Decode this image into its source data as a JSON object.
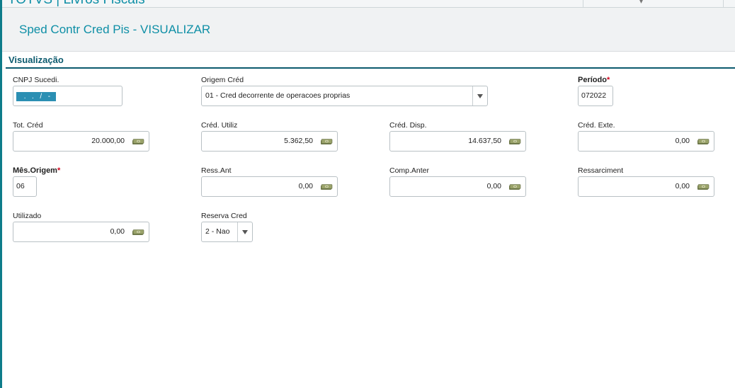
{
  "app": {
    "title": "TOTVS | Livros Fiscais"
  },
  "page": {
    "title": "Sped Contr Cred Pis - VISUALIZAR"
  },
  "section": {
    "title": "Visualização"
  },
  "fields": {
    "cnpj_sucedi": {
      "label": "CNPJ Sucedi.",
      "value": " .  .  /  -"
    },
    "origem_cred": {
      "label": "Origem Créd",
      "value": "01 - Cred decorrente de operacoes proprias"
    },
    "periodo": {
      "label": "Período",
      "required_mark": "*",
      "value": "072022"
    },
    "tot_cred": {
      "label": "Tot. Créd",
      "value": "20.000,00"
    },
    "cred_utiliz": {
      "label": "Créd. Utiliz",
      "value": "5.362,50"
    },
    "cred_disp": {
      "label": "Créd. Disp.",
      "value": "14.637,50"
    },
    "cred_exte": {
      "label": "Créd. Exte.",
      "value": "0,00"
    },
    "mes_origem": {
      "label": "Mês.Origem",
      "required_mark": "*",
      "value": "06"
    },
    "ress_ant": {
      "label": "Ress.Ant",
      "value": "0,00"
    },
    "comp_anter": {
      "label": "Comp.Anter",
      "value": "0,00"
    },
    "ressarciment": {
      "label": "Ressarciment",
      "value": "0,00"
    },
    "utilizado": {
      "label": "Utilizado",
      "value": "0,00"
    },
    "reserva_cred": {
      "label": "Reserva Cred",
      "value": "2 - Nao"
    }
  },
  "colors": {
    "accent": "#0e8fa6",
    "section": "#0b5a6e",
    "required": "#d0021b",
    "selection": "#2b8fb3"
  },
  "icons": {
    "money": "money-icon",
    "dropdown": "chevron-down-icon"
  }
}
